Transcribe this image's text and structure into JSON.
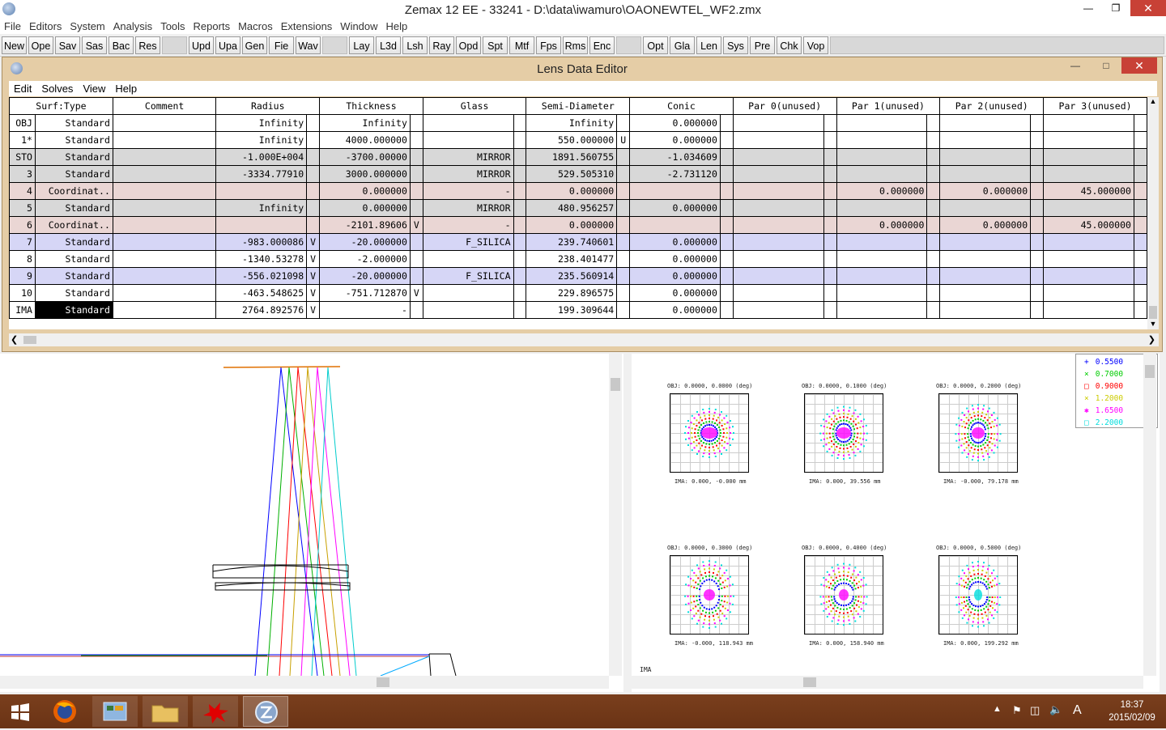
{
  "app_title": "Zemax 12 EE - 33241 - D:\\data\\iwamuro\\OAONEWTEL_WF2.zmx",
  "menu": [
    "File",
    "Editors",
    "System",
    "Analysis",
    "Tools",
    "Reports",
    "Macros",
    "Extensions",
    "Window",
    "Help"
  ],
  "toolbar": {
    "group1": [
      "New",
      "Ope",
      "Sav",
      "Sas",
      "Bac",
      "Res"
    ],
    "group2": [
      "Upd",
      "Upa",
      "Gen",
      "Fie",
      "Wav"
    ],
    "group3": [
      "Lay",
      "L3d",
      "Lsh",
      "Ray",
      "Opd",
      "Spt",
      "Mtf",
      "Fps",
      "Rms",
      "Enc"
    ],
    "group4": [
      "Opt",
      "Gla",
      "Len",
      "Sys",
      "Pre",
      "Chk",
      "Vop"
    ]
  },
  "lde": {
    "title": "Lens Data Editor",
    "menu": [
      "Edit",
      "Solves",
      "View",
      "Help"
    ],
    "headers": [
      "Surf:Type",
      "Comment",
      "Radius",
      "Thickness",
      "Glass",
      "Semi-Diameter",
      "Conic",
      "Par 0(unused)",
      "Par 1(unused)",
      "Par 2(unused)",
      "Par 3(unused)"
    ],
    "rows": [
      {
        "surf": "OBJ",
        "type": "Standard",
        "comment": "",
        "radius": "Infinity",
        "rs": "",
        "thick": "Infinity",
        "ts": "",
        "glass": "",
        "gs": "",
        "semi": "Infinity",
        "ss": "",
        "conic": "0.000000",
        "p1": "",
        "p2": "",
        "p3": "",
        "style": "white"
      },
      {
        "surf": "1*",
        "type": "Standard",
        "comment": "",
        "radius": "Infinity",
        "rs": "",
        "thick": "4000.000000",
        "ts": "",
        "glass": "",
        "gs": "",
        "semi": "550.000000",
        "ss": "U",
        "conic": "0.000000",
        "p1": "",
        "p2": "",
        "p3": "",
        "style": "white"
      },
      {
        "surf": "STO",
        "type": "Standard",
        "comment": "",
        "radius": "-1.000E+004",
        "rs": "",
        "thick": "-3700.00000",
        "ts": "",
        "glass": "MIRROR",
        "gs": "",
        "semi": "1891.560755",
        "ss": "",
        "conic": "-1.034609",
        "p1": "",
        "p2": "",
        "p3": "",
        "style": "gray"
      },
      {
        "surf": "3",
        "type": "Standard",
        "comment": "",
        "radius": "-3334.77910",
        "rs": "",
        "thick": "3000.000000",
        "ts": "",
        "glass": "MIRROR",
        "gs": "",
        "semi": "529.505310",
        "ss": "",
        "conic": "-2.731120",
        "p1": "",
        "p2": "",
        "p3": "",
        "style": "gray"
      },
      {
        "surf": "4",
        "type": "Coordinat..",
        "comment": "",
        "radius": "",
        "rs": "",
        "thick": "0.000000",
        "ts": "",
        "glass": "-",
        "gs": "",
        "semi": "0.000000",
        "ss": "",
        "conic": "",
        "p1": "0.000000",
        "p2": "0.000000",
        "p3": "45.000000",
        "style": "pink"
      },
      {
        "surf": "5",
        "type": "Standard",
        "comment": "",
        "radius": "Infinity",
        "rs": "",
        "thick": "0.000000",
        "ts": "",
        "glass": "MIRROR",
        "gs": "",
        "semi": "480.956257",
        "ss": "",
        "conic": "0.000000",
        "p1": "",
        "p2": "",
        "p3": "",
        "style": "gray"
      },
      {
        "surf": "6",
        "type": "Coordinat..",
        "comment": "",
        "radius": "",
        "rs": "",
        "thick": "-2101.89606",
        "ts": "V",
        "glass": "-",
        "gs": "",
        "semi": "0.000000",
        "ss": "",
        "conic": "",
        "p1": "0.000000",
        "p2": "0.000000",
        "p3": "45.000000",
        "style": "pink"
      },
      {
        "surf": "7",
        "type": "Standard",
        "comment": "",
        "radius": "-983.000086",
        "rs": "V",
        "thick": "-20.000000",
        "ts": "",
        "glass": "F_SILICA",
        "gs": "",
        "semi": "239.740601",
        "ss": "",
        "conic": "0.000000",
        "p1": "",
        "p2": "",
        "p3": "",
        "style": "lav"
      },
      {
        "surf": "8",
        "type": "Standard",
        "comment": "",
        "radius": "-1340.53278",
        "rs": "V",
        "thick": "-2.000000",
        "ts": "",
        "glass": "",
        "gs": "",
        "semi": "238.401477",
        "ss": "",
        "conic": "0.000000",
        "p1": "",
        "p2": "",
        "p3": "",
        "style": "white"
      },
      {
        "surf": "9",
        "type": "Standard",
        "comment": "",
        "radius": "-556.021098",
        "rs": "V",
        "thick": "-20.000000",
        "ts": "",
        "glass": "F_SILICA",
        "gs": "",
        "semi": "235.560914",
        "ss": "",
        "conic": "0.000000",
        "p1": "",
        "p2": "",
        "p3": "",
        "style": "lav"
      },
      {
        "surf": "10",
        "type": "Standard",
        "comment": "",
        "radius": "-463.548625",
        "rs": "V",
        "thick": "-751.712870",
        "ts": "V",
        "glass": "",
        "gs": "",
        "semi": "229.896575",
        "ss": "",
        "conic": "0.000000",
        "p1": "",
        "p2": "",
        "p3": "",
        "style": "white"
      },
      {
        "surf": "IMA",
        "type": "Standard",
        "comment": "",
        "radius": "2764.892576",
        "rs": "V",
        "thick": "-",
        "ts": "",
        "glass": "",
        "gs": "",
        "semi": "199.309644",
        "ss": "",
        "conic": "0.000000",
        "p1": "",
        "p2": "",
        "p3": "",
        "style": "white",
        "selected": true
      }
    ]
  },
  "spot": {
    "legend": [
      {
        "label": "0.5500",
        "color": "#0000ff"
      },
      {
        "label": "0.7000",
        "color": "#00cc00"
      },
      {
        "label": "0.9000",
        "color": "#ff0000"
      },
      {
        "label": "1.2000",
        "color": "#cccc00"
      },
      {
        "label": "1.6500",
        "color": "#ff00ff"
      },
      {
        "label": "2.2000",
        "color": "#00dddd"
      }
    ],
    "fields": [
      {
        "obj": "OBJ: 0.0000, 0.0000 (deg)",
        "ima": "IMA: 0.000, -0.000 mm"
      },
      {
        "obj": "OBJ: 0.0000, 0.1000 (deg)",
        "ima": "IMA: 0.000, 39.556 mm"
      },
      {
        "obj": "OBJ: 0.0000, 0.2000 (deg)",
        "ima": "IMA: -0.000, 79.178 mm"
      },
      {
        "obj": "OBJ: 0.0000, 0.3000 (deg)",
        "ima": "IMA: -0.000, 118.943 mm"
      },
      {
        "obj": "OBJ: 0.0000, 0.4000 (deg)",
        "ima": "IMA: 0.000, 158.940 mm"
      },
      {
        "obj": "OBJ: 0.0000, 0.5000 (deg)",
        "ima": "IMA: 0.000, 199.292 mm"
      }
    ],
    "footer": "IMA"
  },
  "clock": {
    "time": "18:37",
    "date": "2015/02/09"
  },
  "tray_ime": "A"
}
